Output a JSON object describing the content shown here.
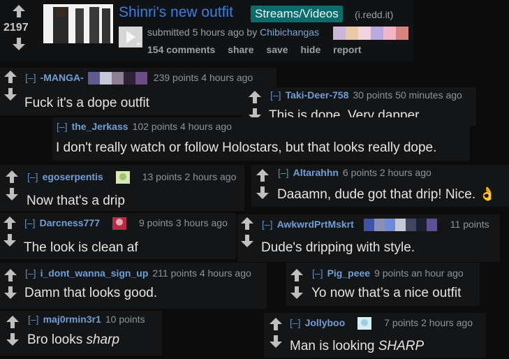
{
  "post": {
    "score": "2197",
    "title": "Shinri's new outfit",
    "flair": "Streams/Videos",
    "domain": "(i.redd.it)",
    "submitted": "submitted 5 hours ago by",
    "author": "Chibichangas",
    "actions": [
      "154 comments",
      "share",
      "save",
      "hide",
      "report"
    ]
  },
  "comments": [
    {
      "toggle": "[–]",
      "user": "-MANGA-",
      "points": "239 points 4 hours ago",
      "body": "Fuck it's a dope outfit",
      "flair_icons": 5
    },
    {
      "toggle": "[–]",
      "user": "Taki-Deer-758",
      "points": "30 points 50 minutes ago",
      "body": "This is dope. Very dapper",
      "flair_icons": 0
    },
    {
      "toggle": "[–]",
      "user": "the_Jerkass",
      "points": "102 points 4 hours ago",
      "body": "I don't really watch or follow Holostars, but that looks really dope.",
      "flair_icons": 0
    },
    {
      "toggle": "[–]",
      "user": "egoserpentis",
      "points": "13 points 2 hours ago",
      "body": "Now that's a drip",
      "flair_icons": 1
    },
    {
      "toggle": "[–]",
      "user": "Altarahhn",
      "points": "6 points 2 hours ago",
      "body": "Daaamn, dude got that drip! Nice. 👌",
      "flair_icons": 0
    },
    {
      "toggle": "[–]",
      "user": "Darcness777",
      "points": "9 points 3 hours ago",
      "body": "The look is clean af",
      "flair_icons": 1
    },
    {
      "toggle": "[–]",
      "user": "AwkwrdPrtMskrt",
      "points": "11 points",
      "body": "Dude's dripping with style.",
      "flair_icons": 7
    },
    {
      "toggle": "[–]",
      "user": "i_dont_wanna_sign_up",
      "points": "211 points 4 hours ago",
      "body": "Damn that looks good.",
      "flair_icons": 0
    },
    {
      "toggle": "[–]",
      "user": "Pig_peee",
      "points": "9 points an hour ago",
      "body": "Yo now that’s a nice outfit",
      "flair_icons": 0
    },
    {
      "toggle": "[–]",
      "user": "maj0rmin3r1",
      "points": "10 points",
      "body_plain": "Bro looks ",
      "body_italic": "sharp",
      "flair_icons": 0
    },
    {
      "toggle": "[–]",
      "user": "Jollyboo",
      "points": "7 points 2 hours ago",
      "body_plain": "Man is looking ",
      "body_italic": "SHARP",
      "flair_icons": 1
    }
  ],
  "colors": {
    "link": "#3b7fe6",
    "flair_bg": "#0d6b6b",
    "username": "#6f9fd6"
  },
  "icons": {
    "upvote": "arrow-up-icon",
    "downvote": "arrow-down-icon",
    "expando": "image-expand-icon"
  }
}
